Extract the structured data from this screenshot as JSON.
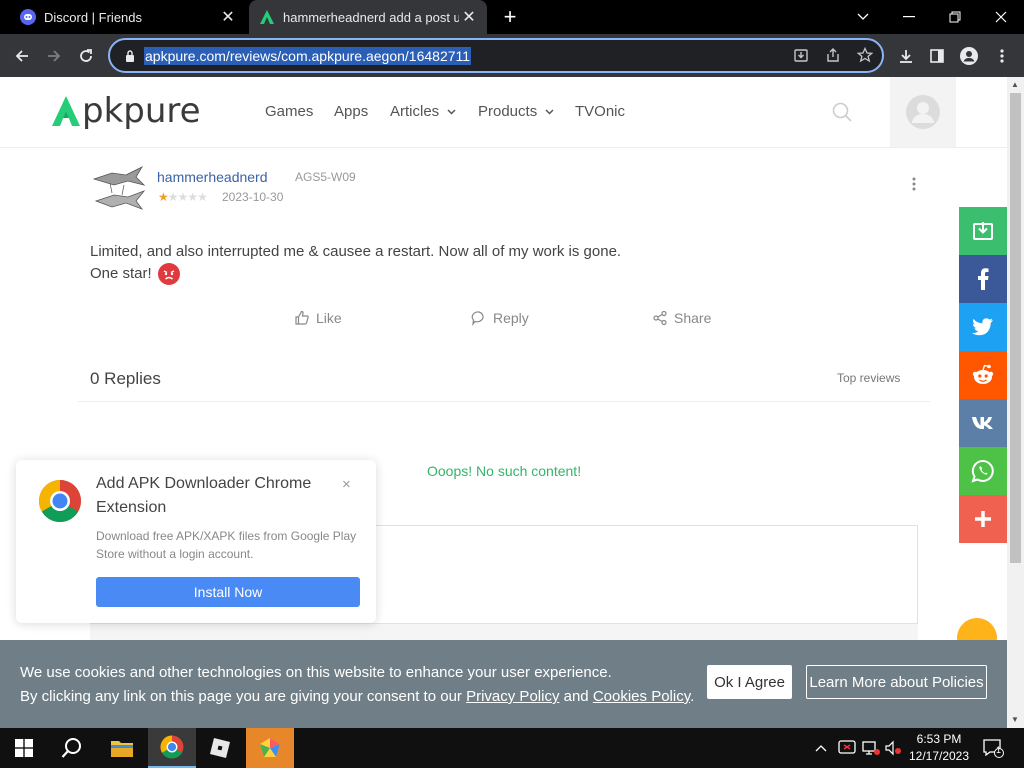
{
  "browser": {
    "tabs": [
      {
        "title": "Discord | Friends",
        "icon": "discord-icon"
      },
      {
        "title": "hammerheadnerd add a post und",
        "icon": "apkpure-icon"
      }
    ],
    "url": "apkpure.com/reviews/com.apkpure.aegon/16482711"
  },
  "site": {
    "logo": "pkpure",
    "nav": [
      {
        "label": "Games"
      },
      {
        "label": "Apps"
      },
      {
        "label": "Articles",
        "dropdown": true
      },
      {
        "label": "Products",
        "dropdown": true
      },
      {
        "label": "TVOnic"
      }
    ]
  },
  "review": {
    "username": "hammerheadnerd",
    "device": "AGS5-W09",
    "rating": 1,
    "max_rating": 5,
    "date": "2023-10-30",
    "text_line1": "Limited, and also interrupted me & causee a restart. Now all of my work is gone.",
    "text_line2": "One star!",
    "actions": {
      "like": "Like",
      "reply": "Reply",
      "share": "Share"
    },
    "replies_label": "0 Replies",
    "sort_label": "Top reviews",
    "empty_message": "Ooops! No such content!"
  },
  "popup": {
    "title": "Add APK Downloader Chrome Extension",
    "description": "Download free APK/XAPK files from Google Play Store without a login account.",
    "button": "Install Now",
    "close": "×"
  },
  "share_bar": [
    {
      "name": "download",
      "color": "#3bbf6e"
    },
    {
      "name": "facebook",
      "color": "#3b5998"
    },
    {
      "name": "twitter",
      "color": "#1da1f2"
    },
    {
      "name": "reddit",
      "color": "#ff5700"
    },
    {
      "name": "vk",
      "color": "#5b7fa6"
    },
    {
      "name": "whatsapp",
      "color": "#4dc247"
    },
    {
      "name": "more",
      "color": "#f0624f"
    }
  ],
  "cookie": {
    "line1": "We use cookies and other technologies on this website to enhance your user experience.",
    "line2_prefix": "By clicking any link on this page you are giving your consent to our ",
    "privacy": "Privacy Policy",
    "and": " and ",
    "cookies": "Cookies Policy",
    "period": ".",
    "agree": "Ok I Agree",
    "learn": "Learn More about Policies"
  },
  "taskbar": {
    "time": "6:53 PM",
    "date": "12/17/2023",
    "notifications": "1"
  },
  "colors": {
    "accent_green": "#33b569",
    "link_blue": "#3a62a8",
    "button_blue": "#4a8af4",
    "cookie_bg": "#707f87"
  }
}
